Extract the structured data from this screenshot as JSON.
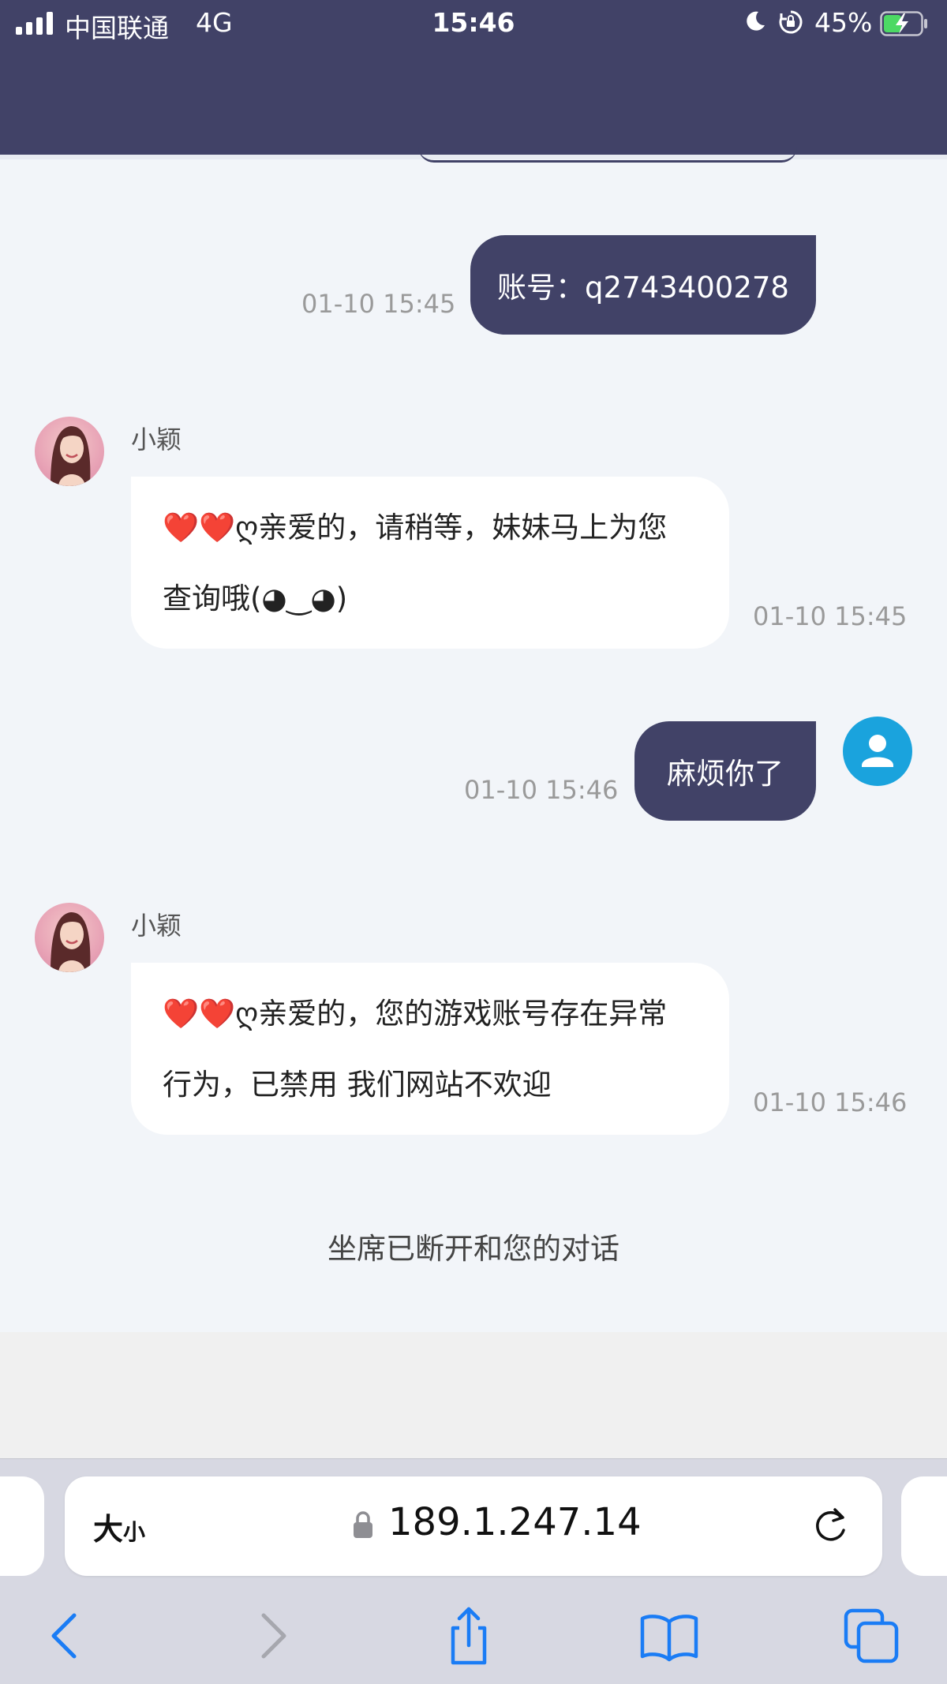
{
  "status_bar": {
    "carrier": "中国联通",
    "network": "4G",
    "time": "15:46",
    "battery": "45%"
  },
  "messages": {
    "m1": {
      "text": "账号：q2743400278",
      "time": "01-10 15:45"
    },
    "m2": {
      "sender": "小颖",
      "line1": "❤️❤️ღ亲爱的，请稍等，妹妹马上为您",
      "line2": "查询哦(◕‿◕)",
      "time": "01-10 15:45"
    },
    "m3": {
      "text": "麻烦你了",
      "time": "01-10 15:46"
    },
    "m4": {
      "sender": "小颖",
      "line1": "❤️❤️ღ亲爱的，您的游戏账号存在异常",
      "line2": "行为，已禁用 我们网站不欢迎",
      "time": "01-10 15:46"
    }
  },
  "system_notice": "坐席已断开和您的对话",
  "browser": {
    "text_size_big": "大",
    "text_size_small": "小",
    "url": "189.1.247.14"
  },
  "colors": {
    "header": "#414267",
    "chat_bg": "#f2f5f9",
    "user_avatar": "#1aa3dd",
    "ios_blue": "#1a7cf5"
  }
}
